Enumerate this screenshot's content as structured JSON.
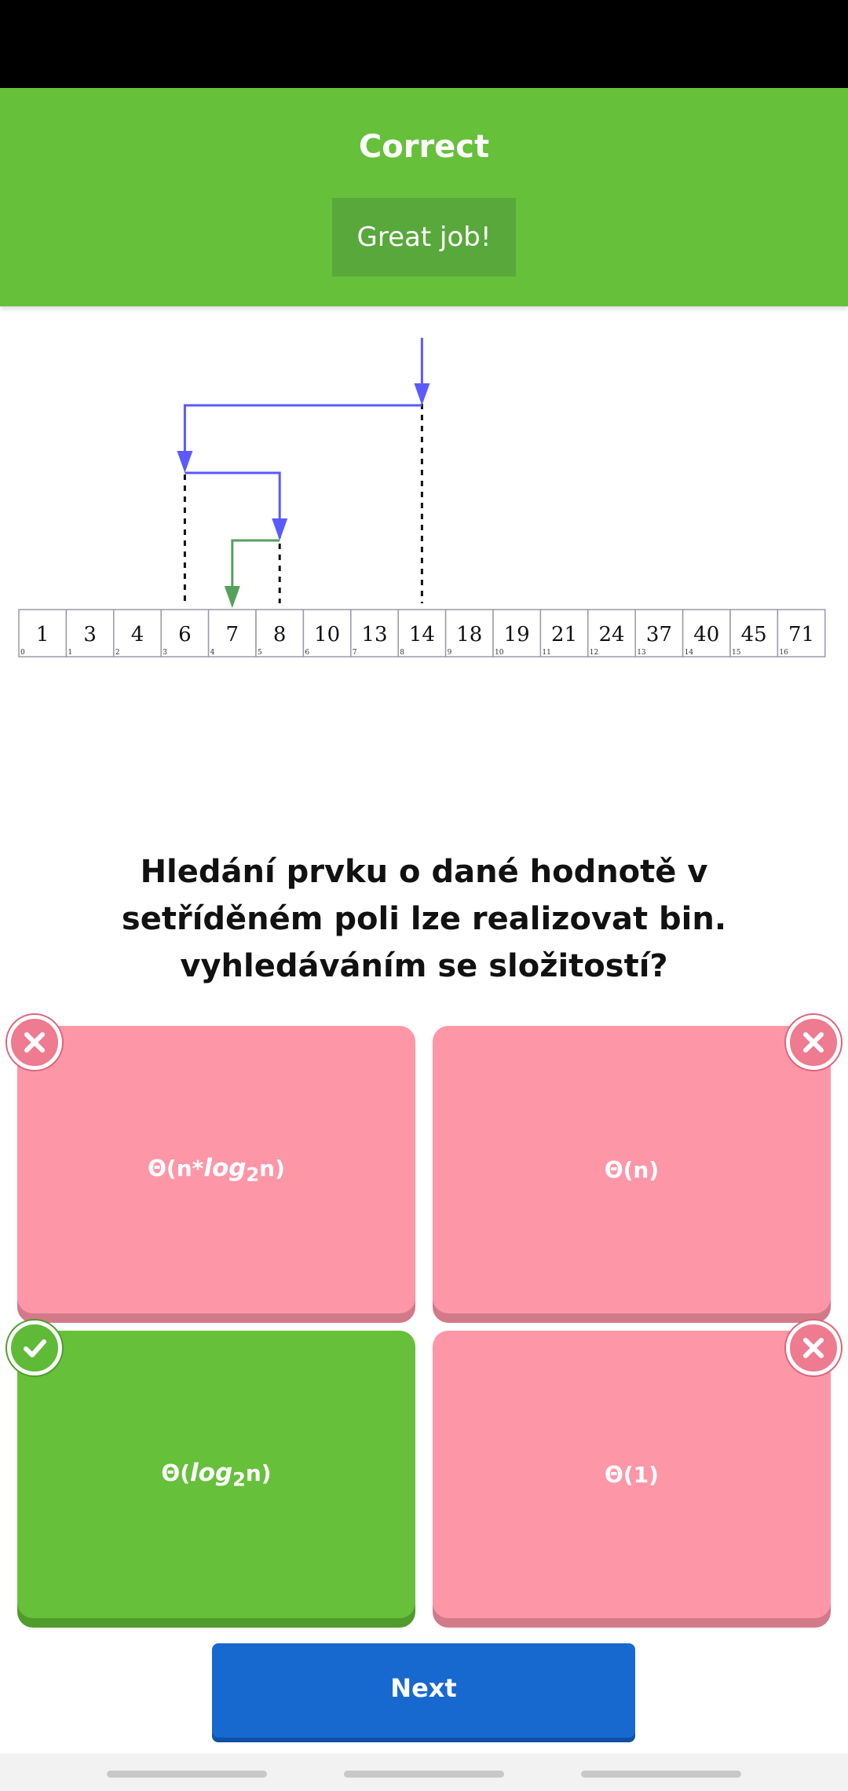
{
  "feedback": {
    "title": "Correct",
    "message": "Great job!"
  },
  "diagram": {
    "array_values": [
      "1",
      "3",
      "4",
      "6",
      "7",
      "8",
      "10",
      "13",
      "14",
      "18",
      "19",
      "21",
      "24",
      "37",
      "40",
      "45",
      "71"
    ],
    "array_indices": [
      "0",
      "1",
      "2",
      "3",
      "4",
      "5",
      "6",
      "7",
      "8",
      "9",
      "10",
      "11",
      "12",
      "13",
      "14",
      "15",
      "16"
    ],
    "colors": {
      "search_arrow": "#5a5aff",
      "found_arrow": "#55a05a"
    }
  },
  "question": {
    "text": "Hledání prvku o dané hodnotě v setříděném poli lze realizovat bin. vyhledáváním se složitostí?"
  },
  "answers": [
    {
      "prefix": "Θ(n*",
      "log": "log",
      "sub": "2",
      "suffix": "n)",
      "state": "wrong"
    },
    {
      "text": "Θ(n)",
      "state": "wrong"
    },
    {
      "prefix": "Θ(",
      "log": "log",
      "sub": "2",
      "suffix": "n)",
      "state": "correct"
    },
    {
      "text": "Θ(1)",
      "state": "wrong"
    }
  ],
  "next_button": {
    "label": "Next"
  },
  "colors": {
    "correct": "#66c03a",
    "wrong": "#fd97a8",
    "primary": "#1769d0"
  }
}
